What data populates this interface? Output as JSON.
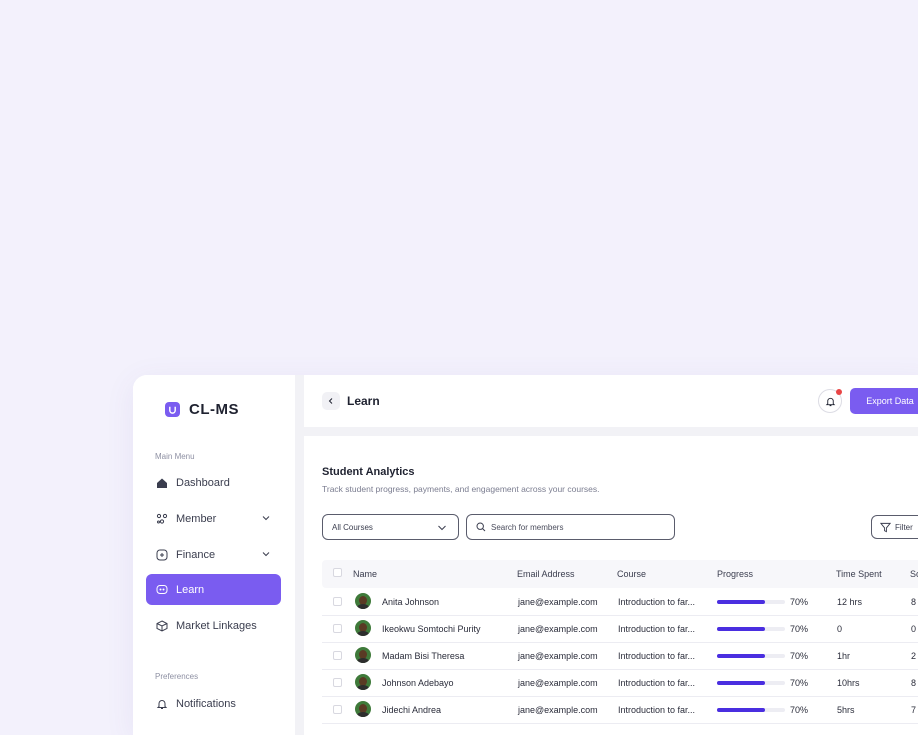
{
  "app": {
    "name": "CL-MS"
  },
  "sidebar": {
    "main_menu_label": "Main Menu",
    "items": [
      {
        "label": "Dashboard",
        "icon": "home-icon"
      },
      {
        "label": "Member",
        "icon": "members-icon",
        "expandable": true
      },
      {
        "label": "Finance",
        "icon": "finance-icon",
        "expandable": true
      },
      {
        "label": "Learn",
        "icon": "chat-icon",
        "active": true
      },
      {
        "label": "Market Linkages",
        "icon": "cube-icon"
      }
    ],
    "preferences_label": "Preferences",
    "pref_items": [
      {
        "label": "Notifications",
        "icon": "bell-icon"
      }
    ]
  },
  "header": {
    "title": "Learn",
    "export_label": "Export Data",
    "notification_dot_color": "#e94545"
  },
  "analytics": {
    "title": "Student Analytics",
    "subtitle": "Track student progress, payments, and engagement across your courses.",
    "course_select_value": "All Courses",
    "search_placeholder": "Search for members",
    "filter_label": "Filter"
  },
  "table": {
    "columns": [
      "Name",
      "Email Address",
      "Course",
      "Progress",
      "Time Spent",
      "Sc"
    ],
    "rows": [
      {
        "name": "Anita Johnson",
        "email": "jane@example.com",
        "course": "Introduction to far...",
        "progress": 0.7,
        "progress_label": "70%",
        "time": "12 hrs",
        "score": "8"
      },
      {
        "name": "Ikeokwu Somtochi Purity",
        "email": "jane@example.com",
        "course": "Introduction to far...",
        "progress": 0.7,
        "progress_label": "70%",
        "time": "0",
        "score": "0"
      },
      {
        "name": "Madam Bisi Theresa",
        "email": "jane@example.com",
        "course": "Introduction to far...",
        "progress": 0.7,
        "progress_label": "70%",
        "time": "1hr",
        "score": "2"
      },
      {
        "name": "Johnson Adebayo",
        "email": "jane@example.com",
        "course": "Introduction to far...",
        "progress": 0.7,
        "progress_label": "70%",
        "time": "10hrs",
        "score": "8"
      },
      {
        "name": "Jidechi Andrea",
        "email": "jane@example.com",
        "course": "Introduction to far...",
        "progress": 0.7,
        "progress_label": "70%",
        "time": "5hrs",
        "score": "7"
      }
    ]
  },
  "colors": {
    "accent": "#7a5cf0",
    "progress": "#4a2ee0",
    "background": "#f3f1fc"
  }
}
